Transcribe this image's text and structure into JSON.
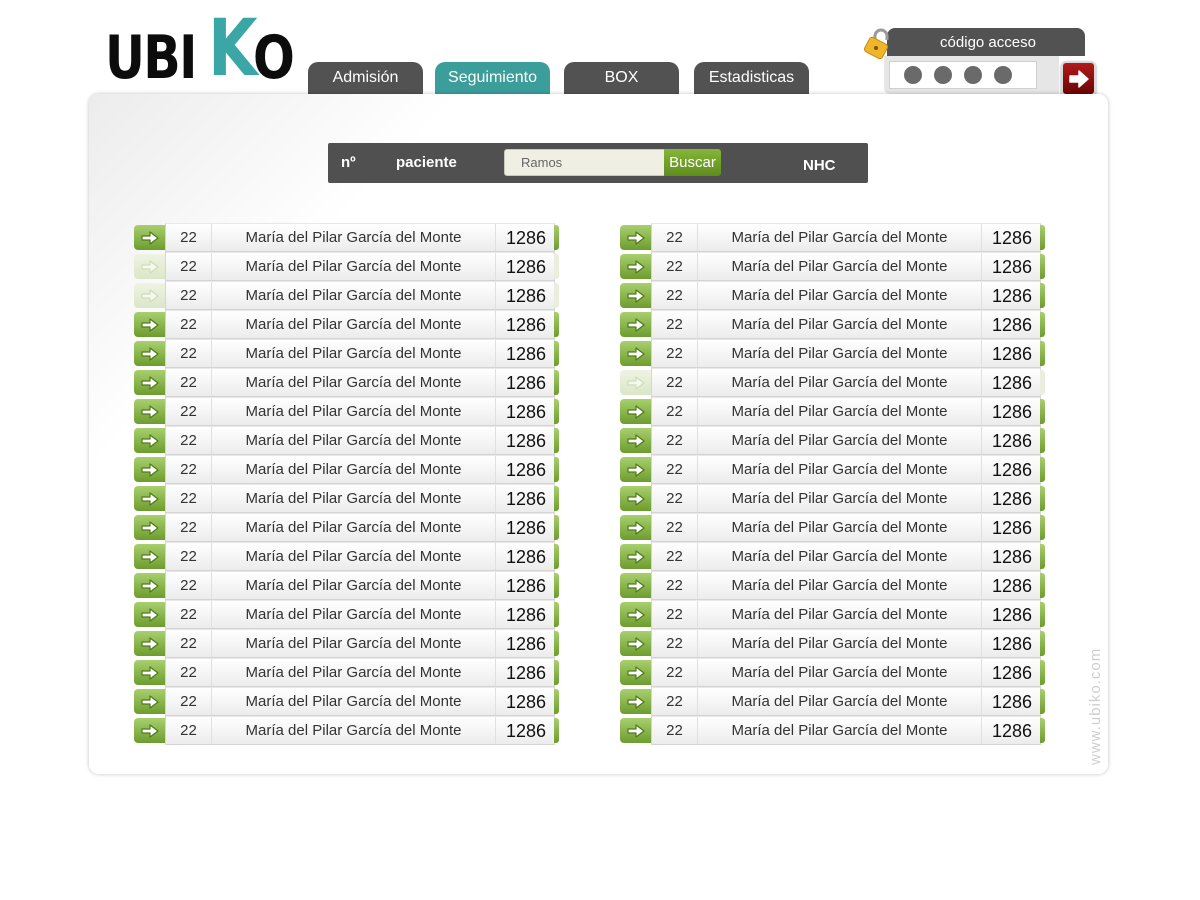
{
  "logo": {
    "part1": "UBI",
    "part2": "K",
    "part3": "O"
  },
  "nav": {
    "tabs": [
      {
        "label": "Admisión",
        "active": false
      },
      {
        "label": "Seguimiento",
        "active": true
      },
      {
        "label": "BOX",
        "active": false
      },
      {
        "label": "Estadisticas",
        "active": false
      }
    ]
  },
  "access": {
    "title": "código acceso",
    "dots": 4
  },
  "search": {
    "col_num": "nº",
    "col_patient": "paciente",
    "value": "Ramos",
    "button": "Buscar",
    "col_nhc": "NHC"
  },
  "patients_left": [
    {
      "num": "22",
      "name": "María del Pilar García del Monte",
      "nhc": "1286",
      "active": true
    },
    {
      "num": "22",
      "name": "María del Pilar García del Monte",
      "nhc": "1286",
      "active": false
    },
    {
      "num": "22",
      "name": "María del Pilar García del Monte",
      "nhc": "1286",
      "active": false
    },
    {
      "num": "22",
      "name": "María del Pilar García del Monte",
      "nhc": "1286",
      "active": true
    },
    {
      "num": "22",
      "name": "María del Pilar García del Monte",
      "nhc": "1286",
      "active": true
    },
    {
      "num": "22",
      "name": "María del Pilar García del Monte",
      "nhc": "1286",
      "active": true
    },
    {
      "num": "22",
      "name": "María del Pilar García del Monte",
      "nhc": "1286",
      "active": true
    },
    {
      "num": "22",
      "name": "María del Pilar García del Monte",
      "nhc": "1286",
      "active": true
    },
    {
      "num": "22",
      "name": "María del Pilar García del Monte",
      "nhc": "1286",
      "active": true
    },
    {
      "num": "22",
      "name": "María del Pilar García del Monte",
      "nhc": "1286",
      "active": true
    },
    {
      "num": "22",
      "name": "María del Pilar García del Monte",
      "nhc": "1286",
      "active": true
    },
    {
      "num": "22",
      "name": "María del Pilar García del Monte",
      "nhc": "1286",
      "active": true
    },
    {
      "num": "22",
      "name": "María del Pilar García del Monte",
      "nhc": "1286",
      "active": true
    },
    {
      "num": "22",
      "name": "María del Pilar García del Monte",
      "nhc": "1286",
      "active": true
    },
    {
      "num": "22",
      "name": "María del Pilar García del Monte",
      "nhc": "1286",
      "active": true
    },
    {
      "num": "22",
      "name": "María del Pilar García del Monte",
      "nhc": "1286",
      "active": true
    },
    {
      "num": "22",
      "name": "María del Pilar García del Monte",
      "nhc": "1286",
      "active": true
    },
    {
      "num": "22",
      "name": "María del Pilar García del Monte",
      "nhc": "1286",
      "active": true
    }
  ],
  "patients_right": [
    {
      "num": "22",
      "name": "María del Pilar García del Monte",
      "nhc": "1286",
      "active": true
    },
    {
      "num": "22",
      "name": "María del Pilar García del Monte",
      "nhc": "1286",
      "active": true
    },
    {
      "num": "22",
      "name": "María del Pilar García del Monte",
      "nhc": "1286",
      "active": true
    },
    {
      "num": "22",
      "name": "María del Pilar García del Monte",
      "nhc": "1286",
      "active": true
    },
    {
      "num": "22",
      "name": "María del Pilar García del Monte",
      "nhc": "1286",
      "active": true
    },
    {
      "num": "22",
      "name": "María del Pilar García del Monte",
      "nhc": "1286",
      "active": false
    },
    {
      "num": "22",
      "name": "María del Pilar García del Monte",
      "nhc": "1286",
      "active": true
    },
    {
      "num": "22",
      "name": "María del Pilar García del Monte",
      "nhc": "1286",
      "active": true
    },
    {
      "num": "22",
      "name": "María del Pilar García del Monte",
      "nhc": "1286",
      "active": true
    },
    {
      "num": "22",
      "name": "María del Pilar García del Monte",
      "nhc": "1286",
      "active": true
    },
    {
      "num": "22",
      "name": "María del Pilar García del Monte",
      "nhc": "1286",
      "active": true
    },
    {
      "num": "22",
      "name": "María del Pilar García del Monte",
      "nhc": "1286",
      "active": true
    },
    {
      "num": "22",
      "name": "María del Pilar García del Monte",
      "nhc": "1286",
      "active": true
    },
    {
      "num": "22",
      "name": "María del Pilar García del Monte",
      "nhc": "1286",
      "active": true
    },
    {
      "num": "22",
      "name": "María del Pilar García del Monte",
      "nhc": "1286",
      "active": true
    },
    {
      "num": "22",
      "name": "María del Pilar García del Monte",
      "nhc": "1286",
      "active": true
    },
    {
      "num": "22",
      "name": "María del Pilar García del Monte",
      "nhc": "1286",
      "active": true
    },
    {
      "num": "22",
      "name": "María del Pilar García del Monte",
      "nhc": "1286",
      "active": true
    }
  ],
  "watermark": "www.ubiko.com",
  "colors": {
    "accent": "#3b9e9a",
    "tab_dark": "#525252",
    "green": "#6d9c2e",
    "red_button": "#8a0c0c"
  }
}
